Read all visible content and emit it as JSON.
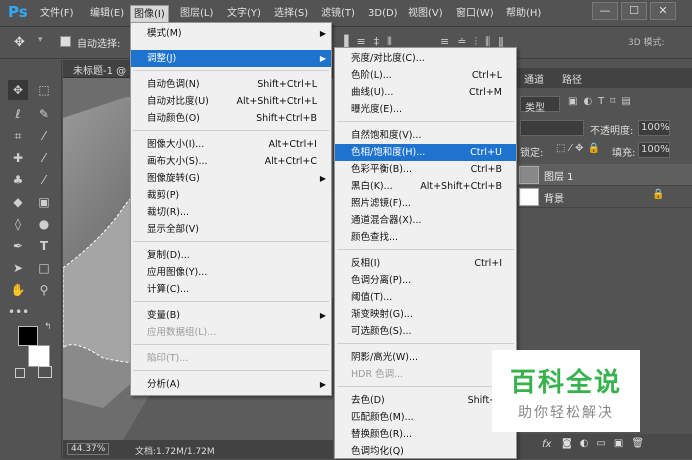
{
  "app": {
    "logo": "Ps"
  },
  "menubar": {
    "items": [
      "文件(F)",
      "编辑(E)",
      "图像(I)",
      "图层(L)",
      "文字(Y)",
      "选择(S)",
      "滤镜(T)",
      "3D(D)",
      "视图(V)",
      "窗口(W)",
      "帮助(H)"
    ],
    "active": "图像(I)"
  },
  "window_controls": {
    "minimize": "—",
    "maximize": "☐",
    "close": "✕"
  },
  "options_bar": {
    "auto_select_label": "自动选择:",
    "mode3d_label": "3D 模式:"
  },
  "document": {
    "tab_title": "未标题-1 @",
    "zoom": "44.37%",
    "doc_info": "文档:1.72M/1.72M"
  },
  "panels": {
    "tabs": [
      "通道",
      "路径"
    ],
    "kind_label": "类型",
    "opacity_label": "不透明度:",
    "opacity_value": "100%",
    "lock_label": "锁定:",
    "fill_label": "填充:",
    "fill_value": "100%",
    "layers": [
      {
        "name": "图层 1"
      },
      {
        "name": "背景"
      }
    ],
    "bottom_icons": [
      "fx"
    ]
  },
  "image_menu": {
    "items": [
      {
        "label": "模式(M)",
        "shortcut": "",
        "submenu": true
      },
      {
        "label": "调整(J)",
        "shortcut": "",
        "submenu": true,
        "highlighted": true
      },
      {
        "label": "自动色调(N)",
        "shortcut": "Shift+Ctrl+L"
      },
      {
        "label": "自动对比度(U)",
        "shortcut": "Alt+Shift+Ctrl+L"
      },
      {
        "label": "自动颜色(O)",
        "shortcut": "Shift+Ctrl+B"
      },
      {
        "label": "图像大小(I)...",
        "shortcut": "Alt+Ctrl+I"
      },
      {
        "label": "画布大小(S)...",
        "shortcut": "Alt+Ctrl+C"
      },
      {
        "label": "图像旋转(G)",
        "shortcut": "",
        "submenu": true
      },
      {
        "label": "裁剪(P)",
        "shortcut": ""
      },
      {
        "label": "裁切(R)...",
        "shortcut": ""
      },
      {
        "label": "显示全部(V)",
        "shortcut": ""
      },
      {
        "label": "复制(D)...",
        "shortcut": ""
      },
      {
        "label": "应用图像(Y)...",
        "shortcut": ""
      },
      {
        "label": "计算(C)...",
        "shortcut": ""
      },
      {
        "label": "变量(B)",
        "shortcut": "",
        "submenu": true
      },
      {
        "label": "应用数据组(L)...",
        "shortcut": "",
        "disabled": true
      },
      {
        "label": "陷印(T)...",
        "shortcut": "",
        "disabled": true
      },
      {
        "label": "分析(A)",
        "shortcut": "",
        "submenu": true
      }
    ]
  },
  "adjust_menu": {
    "items": [
      {
        "label": "亮度/对比度(C)...",
        "shortcut": ""
      },
      {
        "label": "色阶(L)...",
        "shortcut": "Ctrl+L"
      },
      {
        "label": "曲线(U)...",
        "shortcut": "Ctrl+M"
      },
      {
        "label": "曝光度(E)...",
        "shortcut": ""
      },
      {
        "label": "自然饱和度(V)...",
        "shortcut": ""
      },
      {
        "label": "色相/饱和度(H)...",
        "shortcut": "Ctrl+U",
        "highlighted": true
      },
      {
        "label": "色彩平衡(B)...",
        "shortcut": "Ctrl+B"
      },
      {
        "label": "黑白(K)...",
        "shortcut": "Alt+Shift+Ctrl+B"
      },
      {
        "label": "照片滤镜(F)...",
        "shortcut": ""
      },
      {
        "label": "通道混合器(X)...",
        "shortcut": ""
      },
      {
        "label": "颜色查找...",
        "shortcut": ""
      },
      {
        "label": "反相(I)",
        "shortcut": "Ctrl+I"
      },
      {
        "label": "色调分离(P)...",
        "shortcut": ""
      },
      {
        "label": "阈值(T)...",
        "shortcut": ""
      },
      {
        "label": "渐变映射(G)...",
        "shortcut": ""
      },
      {
        "label": "可选颜色(S)...",
        "shortcut": ""
      },
      {
        "label": "阴影/高光(W)...",
        "shortcut": ""
      },
      {
        "label": "HDR 色调...",
        "shortcut": "",
        "disabled": true
      },
      {
        "label": "去色(D)",
        "shortcut": "Shift+Ctrl+"
      },
      {
        "label": "匹配颜色(M)...",
        "shortcut": ""
      },
      {
        "label": "替换颜色(R)...",
        "shortcut": ""
      },
      {
        "label": "色调均化(Q)",
        "shortcut": ""
      }
    ]
  },
  "watermark": {
    "title": "百科全说",
    "subtitle": "助你轻松解决"
  },
  "colors": {
    "accent": "#1e73cf",
    "ui_bg": "#535353",
    "watermark_green": "#37b24d"
  }
}
